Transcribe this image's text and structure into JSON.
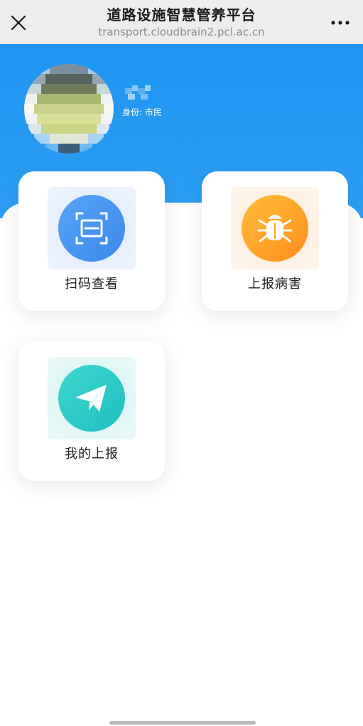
{
  "topbar": {
    "title": "道路设施智慧管养平台",
    "url": "transport.cloudbrain2.pcl.ac.cn",
    "close_icon": "close-icon",
    "more_icon": "more-dots-icon"
  },
  "profile": {
    "identity_label": "身份:",
    "identity_value": "市民"
  },
  "cards": [
    {
      "label": "扫码查看",
      "icon": "scan-icon",
      "color": "#3d8ff2"
    },
    {
      "label": "上报病害",
      "icon": "bug-icon",
      "color": "#ff9f1a"
    },
    {
      "label": "我的上报",
      "icon": "paper-plane-icon",
      "color": "#26cbc5"
    }
  ],
  "colors": {
    "header_blue": "#1f95f1",
    "topbar_bg": "#ededed"
  }
}
